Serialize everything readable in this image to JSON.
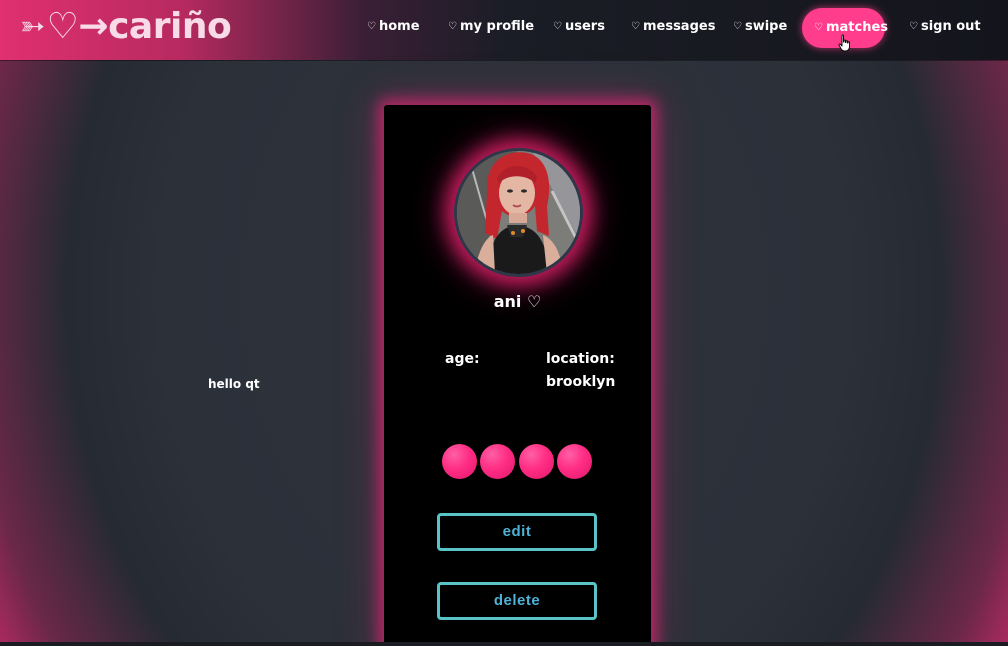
{
  "brand": {
    "arrow_icon": "arrow-tail-icon",
    "heart_icon": "heart-outline-icon",
    "arrow_right": "→",
    "name": "cariño"
  },
  "nav": {
    "items": [
      {
        "label": "home",
        "icon": "heart-icon"
      },
      {
        "label": "my profile",
        "icon": "heart-icon"
      },
      {
        "label": "users",
        "icon": "heart-icon"
      },
      {
        "label": "messages",
        "icon": "heart-icon"
      },
      {
        "label": "swipe",
        "icon": "heart-icon"
      },
      {
        "label": "matches",
        "icon": "heart-icon",
        "active": true
      },
      {
        "label": "sign out",
        "icon": "heart-icon"
      }
    ],
    "heart_glyph": "♡"
  },
  "greeting": "hello qt",
  "profile": {
    "name": "ani",
    "name_heart": "♡",
    "age_label": "age:",
    "age_value": "",
    "location_label": "location:",
    "location_value": "brooklyn",
    "edit_label": "edit",
    "delete_label": "delete"
  },
  "colors": {
    "accent_pink": "#ff3d8c",
    "button_border": "#59c4c8",
    "button_text": "#4fb1d3",
    "card_bg": "#000000"
  }
}
